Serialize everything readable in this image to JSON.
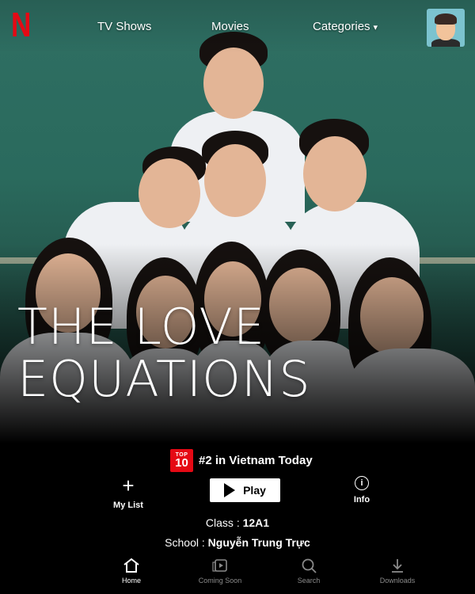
{
  "app": {
    "logo_letter": "N",
    "brand_color": "#e50914"
  },
  "topnav": {
    "tv_shows": "TV Shows",
    "movies": "Movies",
    "categories": "Categories",
    "categories_caret": "▾"
  },
  "show": {
    "title_line1": "THE LOVE",
    "title_line2": "EQUATIONS",
    "top10_badge_top": "TOP",
    "top10_badge_num": "10",
    "rank_text": "#2 in Vietnam Today"
  },
  "actions": {
    "my_list_icon": "+",
    "my_list_label": "My List",
    "play_label": "Play",
    "info_icon": "i",
    "info_label": "Info"
  },
  "meta": {
    "class_label": "Class : ",
    "class_value": "12A1",
    "school_label": "School : ",
    "school_value": "Nguyễn Trung Trực"
  },
  "bottomnav": {
    "home": "Home",
    "coming_soon": "Coming Soon",
    "search": "Search",
    "downloads": "Downloads"
  }
}
